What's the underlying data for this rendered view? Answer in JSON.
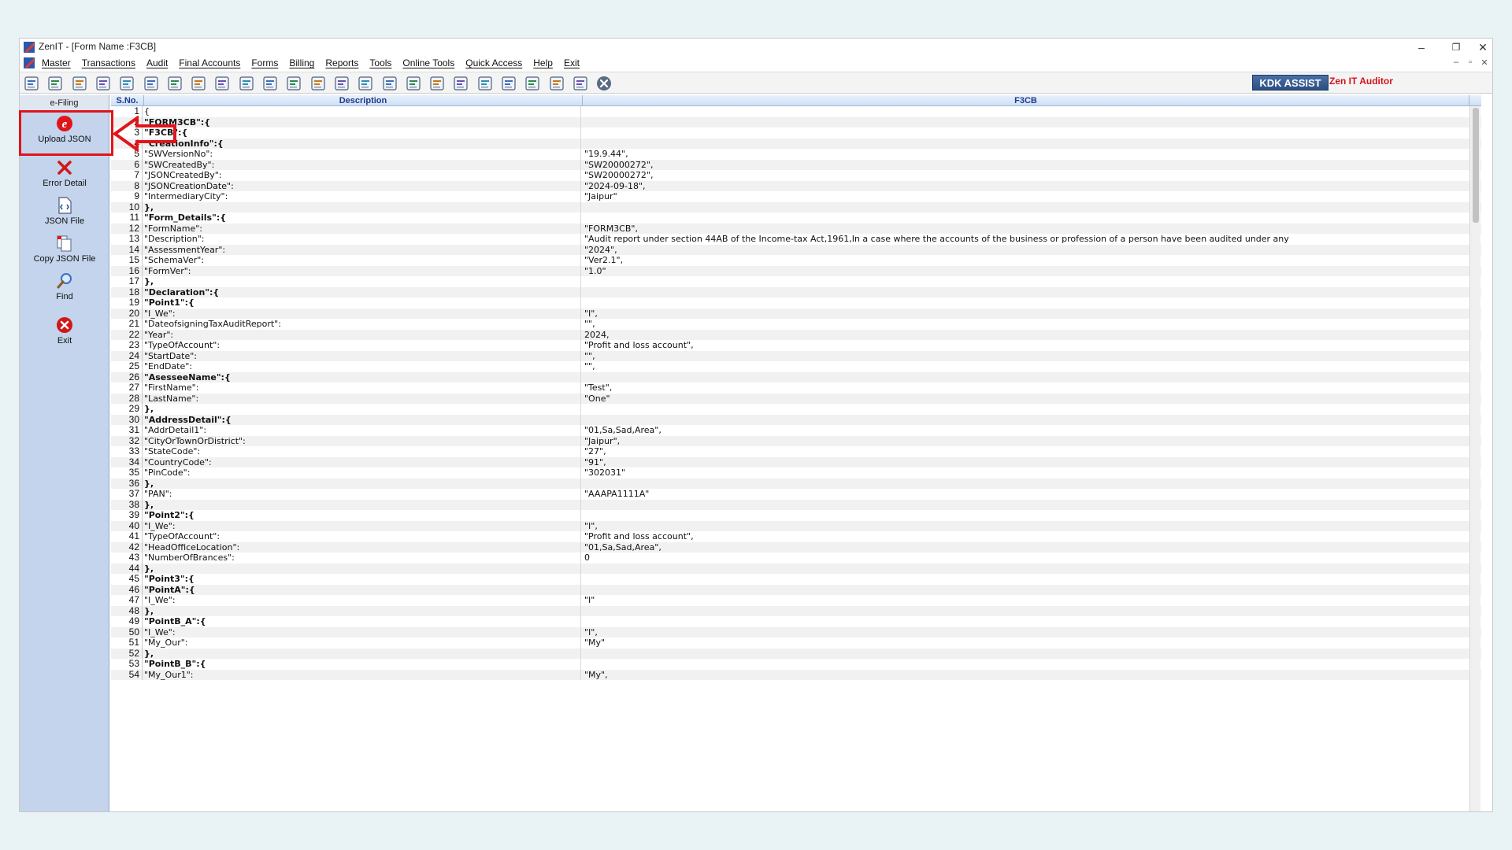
{
  "window": {
    "title": "ZenIT - [Form Name :F3CB]",
    "minimize": "–",
    "restore": "❐",
    "close": "✕"
  },
  "menu": [
    "Master",
    "Transactions",
    "Audit",
    "Final Accounts",
    "Forms",
    "Billing",
    "Reports",
    "Tools",
    "Online Tools",
    "Quick Access",
    "Help",
    "Exit"
  ],
  "mdi": {
    "minimize": "–",
    "restore": "▫",
    "close": "✕"
  },
  "toolbar": {
    "icons": [
      "open-icon",
      "home-icon",
      "building-icon",
      "bar-chart-icon",
      "gift-icon",
      "users-icon",
      "tag-icon",
      "filter-icon",
      "tax-icon",
      "disc-icon",
      "calculator-icon",
      "pie-icon",
      "pay-icon",
      "book-icon",
      "info-icon",
      "report-icon",
      "doc-user-icon",
      "calendar-icon",
      "shield-icon",
      "export-icon",
      "bs-icon",
      "group-icon",
      "3cd-icon",
      "form-icon",
      "close-circle-icon"
    ],
    "brand_label": "KDK ASSIST",
    "brand_tagline": "Zen IT Auditor"
  },
  "sidebar": {
    "header": "e-Filing",
    "items": [
      {
        "label": "Upload JSON",
        "icon": "e-upload-icon"
      },
      {
        "label": "Error Detail",
        "icon": "error-x-icon"
      },
      {
        "label": "JSON File",
        "icon": "json-file-icon"
      },
      {
        "label": "Copy JSON File",
        "icon": "copy-file-icon"
      },
      {
        "label": "Find",
        "icon": "find-icon"
      },
      {
        "label": "Exit",
        "icon": "exit-icon"
      }
    ]
  },
  "grid": {
    "col_sno": "S.No.",
    "col_desc": "Description",
    "col_value": "F3CB",
    "rows": [
      {
        "n": "1",
        "d": "{",
        "v": "",
        "b": false
      },
      {
        "n": "2",
        "d": "\"FORM3CB\":{",
        "v": "",
        "b": true
      },
      {
        "n": "3",
        "d": "\"F3CB\":{",
        "v": "",
        "b": true
      },
      {
        "n": "4",
        "d": "\"CreationInfo\":{",
        "v": "",
        "b": true
      },
      {
        "n": "5",
        "d": "\"SWVersionNo\":",
        "v": "\"19.9.44\",",
        "b": false
      },
      {
        "n": "6",
        "d": "\"SWCreatedBy\":",
        "v": "\"SW20000272\",",
        "b": false
      },
      {
        "n": "7",
        "d": "\"JSONCreatedBy\":",
        "v": "\"SW20000272\",",
        "b": false
      },
      {
        "n": "8",
        "d": "\"JSONCreationDate\":",
        "v": "\"2024-09-18\",",
        "b": false
      },
      {
        "n": "9",
        "d": "\"IntermediaryCity\":",
        "v": "\"Jaipur\"",
        "b": false
      },
      {
        "n": "10",
        "d": "},",
        "v": "",
        "b": true
      },
      {
        "n": "11",
        "d": "\"Form_Details\":{",
        "v": "",
        "b": true
      },
      {
        "n": "12",
        "d": "\"FormName\":",
        "v": "\"FORM3CB\",",
        "b": false
      },
      {
        "n": "13",
        "d": "\"Description\":",
        "v": "\"Audit report under section 44AB of the Income-tax Act,1961,In a case where the accounts of the business or profession of a person have been audited under any",
        "b": false
      },
      {
        "n": "14",
        "d": "\"AssessmentYear\":",
        "v": "\"2024\",",
        "b": false
      },
      {
        "n": "15",
        "d": "\"SchemaVer\":",
        "v": "\"Ver2.1\",",
        "b": false
      },
      {
        "n": "16",
        "d": "\"FormVer\":",
        "v": "\"1.0\"",
        "b": false
      },
      {
        "n": "17",
        "d": "},",
        "v": "",
        "b": true
      },
      {
        "n": "18",
        "d": "\"Declaration\":{",
        "v": "",
        "b": true
      },
      {
        "n": "19",
        "d": "\"Point1\":{",
        "v": "",
        "b": true
      },
      {
        "n": "20",
        "d": "\"I_We\":",
        "v": "\"I\",",
        "b": false
      },
      {
        "n": "21",
        "d": "\"DateofsigningTaxAuditReport\":",
        "v": "\"\",",
        "b": false
      },
      {
        "n": "22",
        "d": "\"Year\":",
        "v": "2024,",
        "b": false
      },
      {
        "n": "23",
        "d": "\"TypeOfAccount\":",
        "v": "\"Profit and loss account\",",
        "b": false
      },
      {
        "n": "24",
        "d": "\"StartDate\":",
        "v": "\"\",",
        "b": false
      },
      {
        "n": "25",
        "d": "\"EndDate\":",
        "v": "\"\",",
        "b": false
      },
      {
        "n": "26",
        "d": "\"AsesseeName\":{",
        "v": "",
        "b": true
      },
      {
        "n": "27",
        "d": "\"FirstName\":",
        "v": "\"Test\",",
        "b": false
      },
      {
        "n": "28",
        "d": "\"LastName\":",
        "v": "\"One\"",
        "b": false
      },
      {
        "n": "29",
        "d": "},",
        "v": "",
        "b": true
      },
      {
        "n": "30",
        "d": "\"AddressDetail\":{",
        "v": "",
        "b": true
      },
      {
        "n": "31",
        "d": "\"AddrDetail1\":",
        "v": "\"01,Sa,Sad,Area\",",
        "b": false
      },
      {
        "n": "32",
        "d": "\"CityOrTownOrDistrict\":",
        "v": "\"Jaipur\",",
        "b": false
      },
      {
        "n": "33",
        "d": "\"StateCode\":",
        "v": "\"27\",",
        "b": false
      },
      {
        "n": "34",
        "d": "\"CountryCode\":",
        "v": "\"91\",",
        "b": false
      },
      {
        "n": "35",
        "d": "\"PinCode\":",
        "v": "\"302031\"",
        "b": false
      },
      {
        "n": "36",
        "d": "},",
        "v": "",
        "b": true
      },
      {
        "n": "37",
        "d": "\"PAN\":",
        "v": "\"AAAPA1111A\"",
        "b": false
      },
      {
        "n": "38",
        "d": "},",
        "v": "",
        "b": true
      },
      {
        "n": "39",
        "d": "\"Point2\":{",
        "v": "",
        "b": true
      },
      {
        "n": "40",
        "d": "\"I_We\":",
        "v": "\"I\",",
        "b": false
      },
      {
        "n": "41",
        "d": "\"TypeOfAccount\":",
        "v": "\"Profit and loss account\",",
        "b": false
      },
      {
        "n": "42",
        "d": "\"HeadOfficeLocation\":",
        "v": "\"01,Sa,Sad,Area\",",
        "b": false
      },
      {
        "n": "43",
        "d": "\"NumberOfBrances\":",
        "v": "0",
        "b": false
      },
      {
        "n": "44",
        "d": "},",
        "v": "",
        "b": true
      },
      {
        "n": "45",
        "d": "\"Point3\":{",
        "v": "",
        "b": true
      },
      {
        "n": "46",
        "d": "\"PointA\":{",
        "v": "",
        "b": true
      },
      {
        "n": "47",
        "d": "\"I_We\":",
        "v": "\"I\"",
        "b": false
      },
      {
        "n": "48",
        "d": "},",
        "v": "",
        "b": true
      },
      {
        "n": "49",
        "d": "\"PointB_A\":{",
        "v": "",
        "b": true
      },
      {
        "n": "50",
        "d": "\"I_We\":",
        "v": "\"I\",",
        "b": false
      },
      {
        "n": "51",
        "d": "\"My_Our\":",
        "v": "\"My\"",
        "b": false
      },
      {
        "n": "52",
        "d": "},",
        "v": "",
        "b": true
      },
      {
        "n": "53",
        "d": "\"PointB_B\":{",
        "v": "",
        "b": true
      },
      {
        "n": "54",
        "d": "\"My_Our1\":",
        "v": "\"My\",",
        "b": false
      }
    ]
  },
  "colors": {
    "highlight": "#e0151c",
    "sidebar": "#c3d4ec",
    "header_text": "#1f3b8a"
  }
}
